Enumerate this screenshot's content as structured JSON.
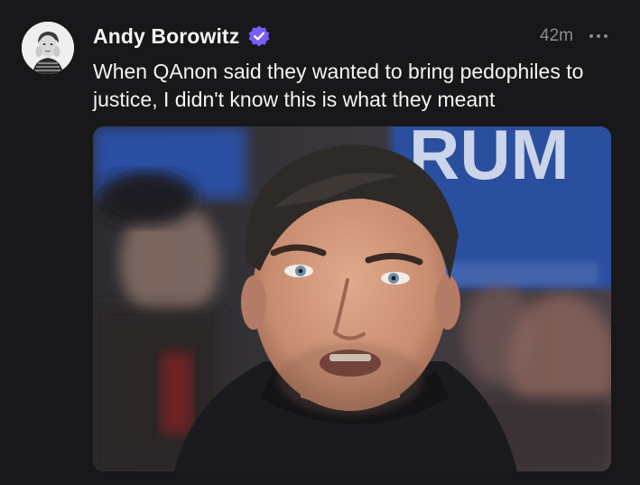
{
  "post": {
    "author": {
      "display_name": "Andy Borowitz",
      "avatar_icon": "avatar-photo",
      "verified_icon": "verified-badge-icon",
      "verified_color": "#7b5cff"
    },
    "timestamp": "42m",
    "more_icon": "more-options-icon",
    "text": "When QAnon said they wanted to bring pedophiles to justice, I didn't know this is what they meant",
    "media": {
      "type": "photo",
      "sign_lettering": "RUM"
    }
  },
  "colors": {
    "background": "#18181b",
    "text_primary": "#f4f4f5",
    "text_secondary": "#8a8a93",
    "accent": "#7b5cff"
  }
}
